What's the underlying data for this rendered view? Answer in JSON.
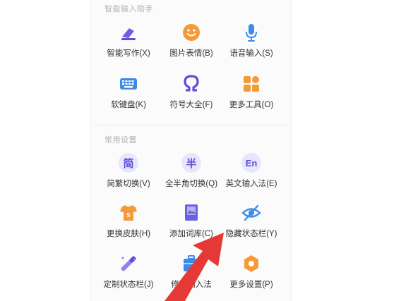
{
  "sections": {
    "smart": {
      "title": "智能输入助手"
    },
    "common": {
      "title": "常用设置"
    }
  },
  "tools": {
    "smart_write": {
      "label": "智能写作(X)",
      "icon": "pencil-eraser-icon"
    },
    "emoji": {
      "label": "图片表情(B)",
      "icon": "smiley-icon"
    },
    "voice": {
      "label": "语音输入(S)",
      "icon": "microphone-icon"
    },
    "soft_kb": {
      "label": "软键盘(K)",
      "icon": "keyboard-icon"
    },
    "symbols": {
      "label": "符号大全(F)",
      "icon": "omega-icon"
    },
    "more_tools": {
      "label": "更多工具(O)",
      "icon": "grid-icon"
    },
    "trad_simp": {
      "label": "简繁切换(V)",
      "icon": "jian-icon",
      "glyph": "简"
    },
    "half_full": {
      "label": "全半角切换(Q)",
      "icon": "ban-icon",
      "glyph": "半"
    },
    "english": {
      "label": "英文输入法(E)",
      "icon": "en-icon",
      "glyph": "En"
    },
    "skin": {
      "label": "更换皮肤(H)",
      "icon": "tshirt-icon"
    },
    "dict": {
      "label": "添加词库(C)",
      "icon": "book-icon"
    },
    "hide_bar": {
      "label": "隐藏状态栏(Y)",
      "icon": "eye-hidden-icon"
    },
    "custom_bar": {
      "label": "定制状态栏(J)",
      "icon": "magic-wand-icon"
    },
    "repair": {
      "label": "修复输入法",
      "icon": "toolbox-icon"
    },
    "more_settings": {
      "label": "更多设置(P)",
      "icon": "gear-icon"
    }
  },
  "colors": {
    "accent": "#5b4fd9",
    "orange": "#f59a3a",
    "blue": "#3d8be6",
    "arrow": "#e53935"
  }
}
